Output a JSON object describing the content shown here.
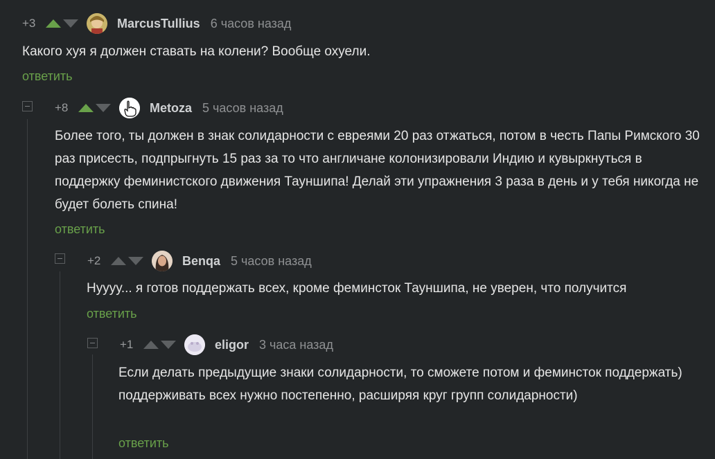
{
  "comments": [
    {
      "rating": "+3",
      "username": "MarcusTullius",
      "time": "6 часов назад",
      "text": "Какого хуя я должен ставать на колени? Вообще охуели.",
      "reply": "ответить",
      "up_active": true,
      "avatar_icon": "avatar-icon"
    },
    {
      "rating": "+8",
      "username": "Metoza",
      "time": "5 часов назад",
      "text": "Более того, ты должен в знак солидарности с евреями 20 раз отжаться, потом в честь Папы Римского 30 раз присесть, подпрыгнуть 15 раз за то что англичане колонизировали Индию и кувыркнуться в поддержку феминистского движения Тауншипа! Делай эти упражнения 3 раза в день и у тебя никогда не будет болеть спина!",
      "reply": "ответить",
      "up_active": true,
      "avatar_icon": "pointing-hand-icon"
    },
    {
      "rating": "+2",
      "username": "Benqa",
      "time": "5 часов назад",
      "text": "Нуууу... я готов поддержать всех, кроме феминсток Тауншипа, не уверен, что получится",
      "reply": "ответить",
      "up_active": false,
      "avatar_icon": "avatar-icon"
    },
    {
      "rating": "+1",
      "username": "eligor",
      "time": "3 часа назад",
      "text": "Если делать предыдущие знаки солидарности, то сможете потом и феминсток поддержать) поддерживать всех нужно постепенно, расширяя круг групп солидарности)",
      "reply": "ответить",
      "up_active": false,
      "avatar_icon": "avatar-icon"
    }
  ],
  "colors": {
    "background": "#232628",
    "accent_green": "#69a14a",
    "text": "#e6e6e6",
    "meta": "#8f9193"
  }
}
